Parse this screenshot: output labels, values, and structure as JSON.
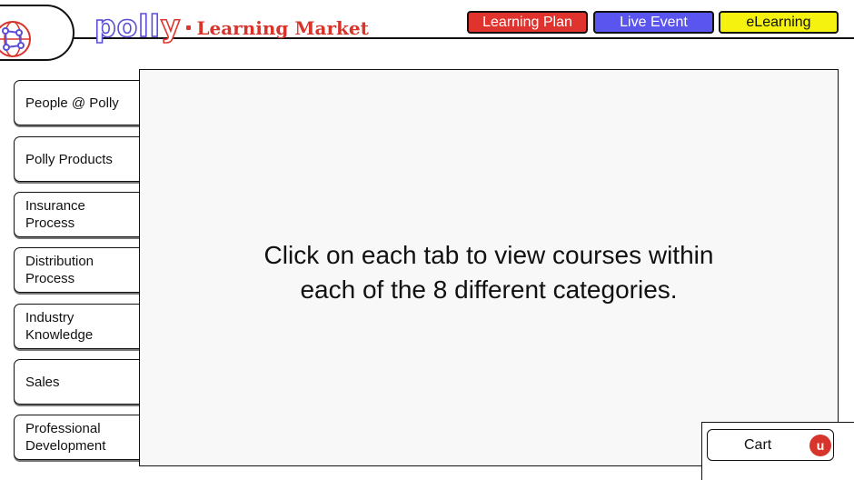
{
  "header": {
    "brand_word_left": "poll",
    "brand_word_right": "y",
    "brand_subtitle": "Learning Market",
    "tabs": [
      {
        "label": "Learning Plan"
      },
      {
        "label": "Live Event"
      },
      {
        "label": "eLearning"
      }
    ]
  },
  "sidebar": {
    "items": [
      {
        "label": "People @ Polly"
      },
      {
        "label": "Polly Products"
      },
      {
        "label": "Insurance Process"
      },
      {
        "label": "Distribution Process"
      },
      {
        "label": "Industry Knowledge"
      },
      {
        "label": "Sales"
      },
      {
        "label": "Professional Development"
      }
    ]
  },
  "main": {
    "message_line1": "Click on each tab to view courses within",
    "message_line2": "each of the 8 different categories."
  },
  "cart": {
    "label": "Cart",
    "badge": "u"
  },
  "colors": {
    "learning_plan": "#e0332d",
    "live_event": "#5b55f0",
    "elearning": "#f4f20e",
    "brand_red": "#d7352b",
    "brand_purple": "#5a4fd6"
  }
}
